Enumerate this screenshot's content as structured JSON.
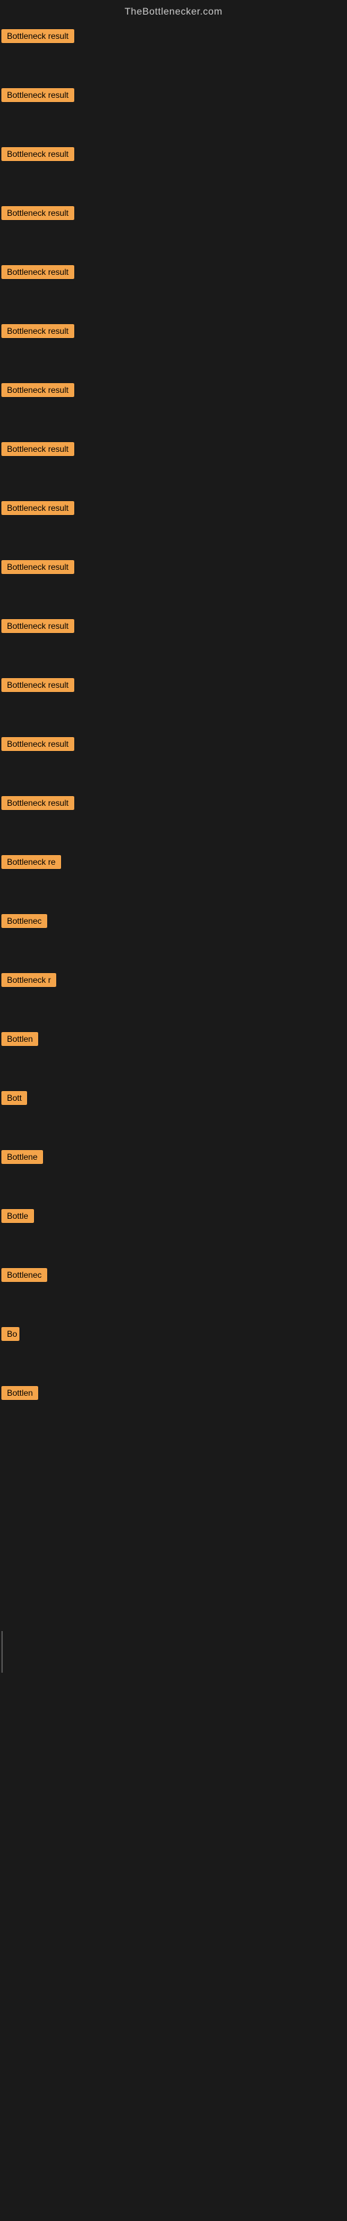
{
  "header": {
    "site_title": "TheBottlenecker.com"
  },
  "rows": [
    {
      "id": 1,
      "label": "Bottleneck result"
    },
    {
      "id": 2,
      "label": "Bottleneck result"
    },
    {
      "id": 3,
      "label": "Bottleneck result"
    },
    {
      "id": 4,
      "label": "Bottleneck result"
    },
    {
      "id": 5,
      "label": "Bottleneck result"
    },
    {
      "id": 6,
      "label": "Bottleneck result"
    },
    {
      "id": 7,
      "label": "Bottleneck result"
    },
    {
      "id": 8,
      "label": "Bottleneck result"
    },
    {
      "id": 9,
      "label": "Bottleneck result"
    },
    {
      "id": 10,
      "label": "Bottleneck result"
    },
    {
      "id": 11,
      "label": "Bottleneck result"
    },
    {
      "id": 12,
      "label": "Bottleneck result"
    },
    {
      "id": 13,
      "label": "Bottleneck result"
    },
    {
      "id": 14,
      "label": "Bottleneck result"
    },
    {
      "id": 15,
      "label": "Bottleneck re"
    },
    {
      "id": 16,
      "label": "Bottlenec"
    },
    {
      "id": 17,
      "label": "Bottleneck r"
    },
    {
      "id": 18,
      "label": "Bottlen"
    },
    {
      "id": 19,
      "label": "Bott"
    },
    {
      "id": 20,
      "label": "Bottlene"
    },
    {
      "id": 21,
      "label": "Bottle"
    },
    {
      "id": 22,
      "label": "Bottlenec"
    },
    {
      "id": 23,
      "label": "Bo"
    },
    {
      "id": 24,
      "label": "Bottlen"
    }
  ],
  "colors": {
    "badge_bg": "#f4a44a",
    "badge_text": "#000000",
    "title_text": "#cccccc",
    "background": "#1a1a1a"
  }
}
